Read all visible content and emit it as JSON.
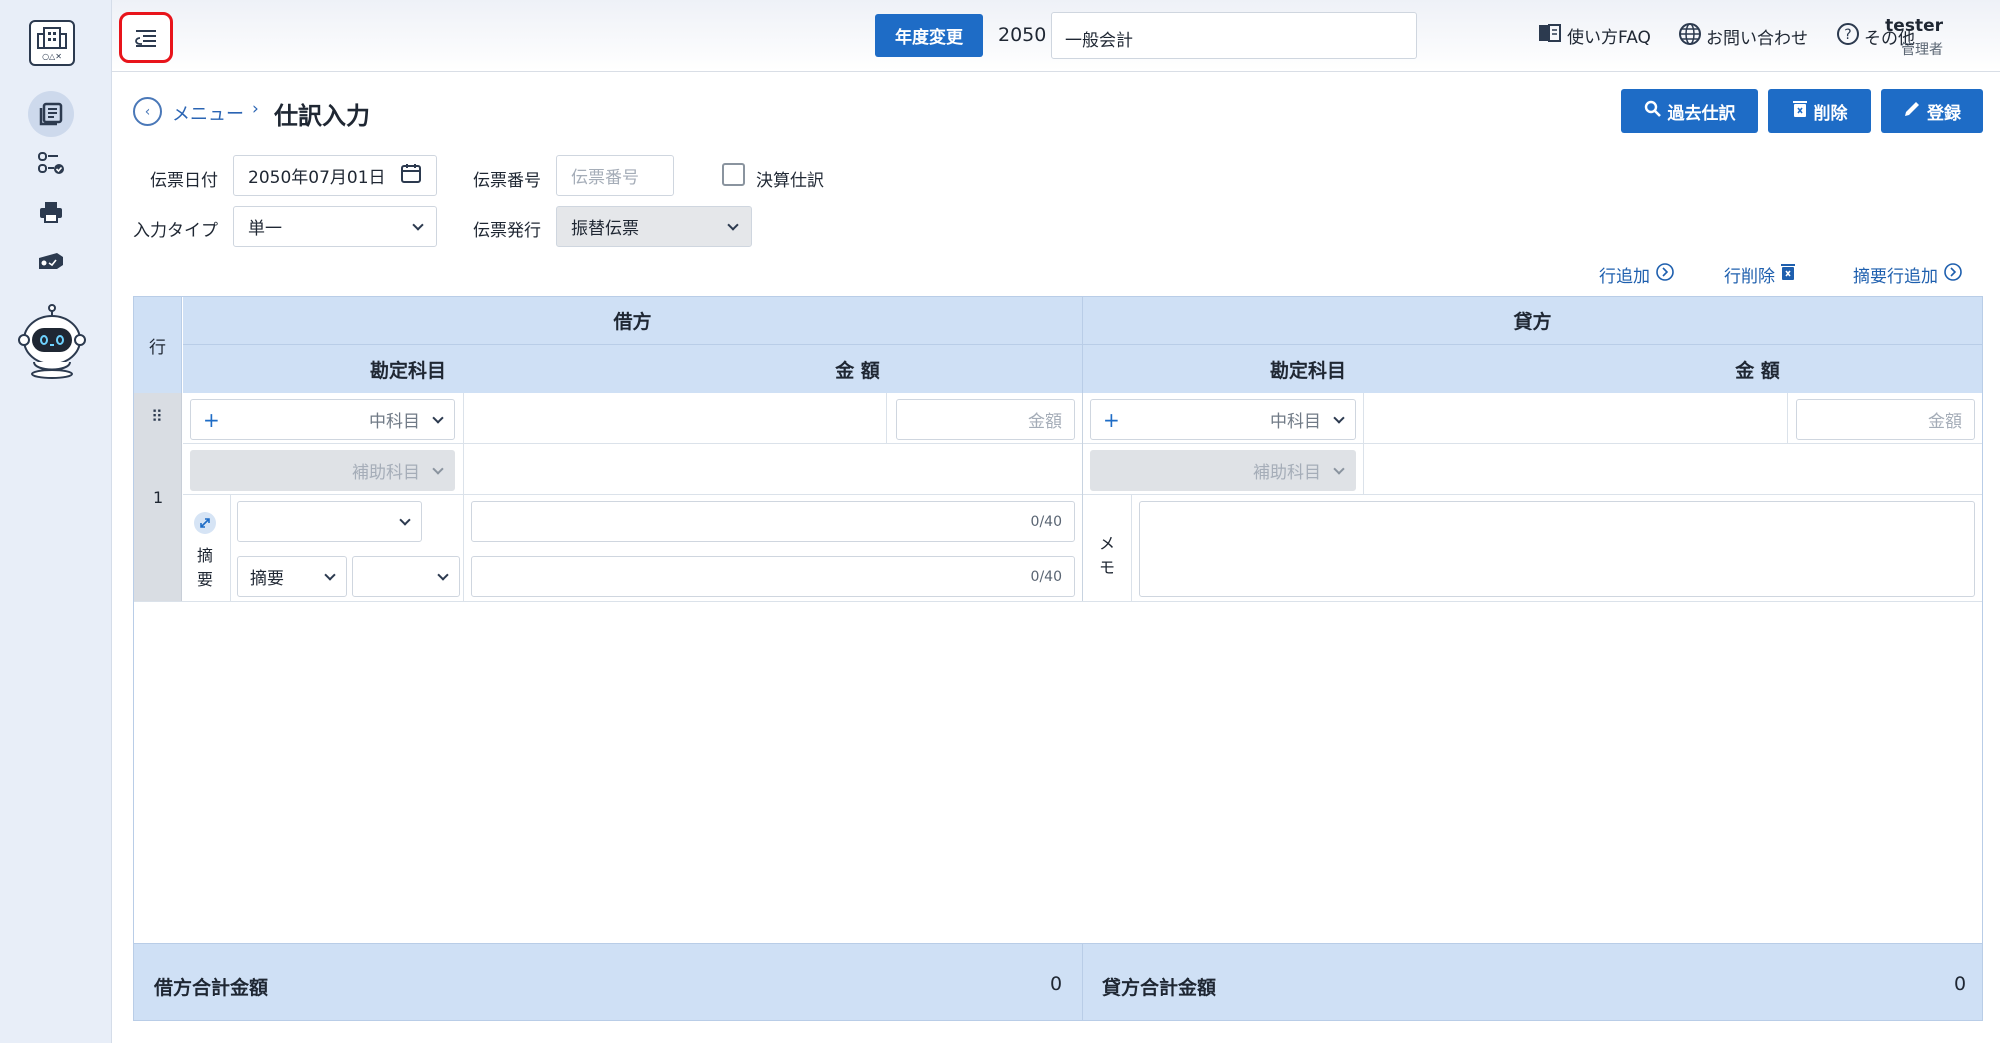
{
  "header": {
    "year_button": "年度変更",
    "year": "2050",
    "book": "一般会計",
    "faq": "使い方FAQ",
    "contact": "お問い合わせ",
    "other": "その他",
    "user_name": "tester",
    "user_role": "管理者"
  },
  "breadcrumb": {
    "menu": "メニュー",
    "separator": "›",
    "title": "仕訳入力"
  },
  "actions": {
    "past": "過去仕訳",
    "delete": "削除",
    "register": "登録"
  },
  "form": {
    "date_label": "伝票日付",
    "date_value": "2050年07月01日",
    "number_label": "伝票番号",
    "number_placeholder": "伝票番号",
    "closing_label": "決算仕訳",
    "input_type_label": "入力タイプ",
    "input_type_value": "単一",
    "issue_label": "伝票発行",
    "issue_value": "振替伝票"
  },
  "table_links": {
    "add_row": "行追加",
    "delete_row": "行削除",
    "add_summary": "摘要行追加"
  },
  "table": {
    "row_header": "行",
    "debit": "借方",
    "credit": "貸方",
    "account": "勘定科目",
    "amount": "金 額",
    "row_number": "1",
    "mid_account_placeholder": "中科目",
    "amount_placeholder": "金額",
    "sub_account_placeholder": "補助科目",
    "summary_label_1": "摘",
    "summary_label_2": "要",
    "memo_label_1": "メ",
    "memo_label_2": "モ",
    "summary_select": "摘要",
    "counter_1": "0/40",
    "counter_2": "0/40"
  },
  "totals": {
    "debit_label": "借方合計金額",
    "debit_value": "0",
    "credit_label": "貸方合計金額",
    "credit_value": "0"
  },
  "colors": {
    "primary": "#1e6cc6",
    "header_bg": "#cfe0f5",
    "highlight": "#e8141b",
    "sidebar": "#e8eef8"
  }
}
